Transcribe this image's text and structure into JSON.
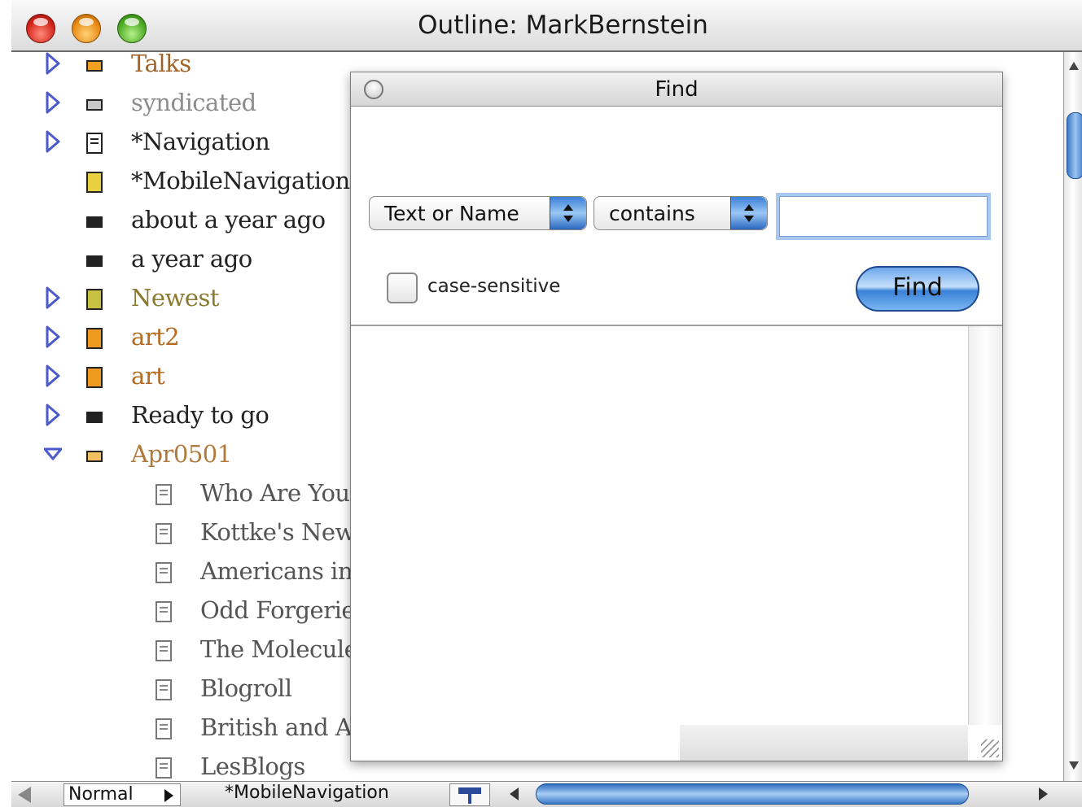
{
  "window": {
    "title": "Outline: MarkBernstein"
  },
  "outline": {
    "items": [
      {
        "label": "Talks",
        "expand": "collapsed",
        "level": 0,
        "icon": "flat",
        "icon_color": "#f0a020",
        "text_color": "#a06428"
      },
      {
        "label": "syndicated",
        "expand": "collapsed",
        "level": 0,
        "icon": "flat",
        "icon_color": "#c8c8c8",
        "text_color": "#8c8c8c"
      },
      {
        "label": "*Navigation",
        "expand": "collapsed",
        "level": 0,
        "icon": "doc",
        "icon_color": "#222222",
        "text_color": "#222222"
      },
      {
        "label": "*MobileNavigation",
        "expand": "none",
        "level": 0,
        "icon": "doc",
        "icon_color": "#e8d040",
        "text_color": "#222222"
      },
      {
        "label": "about a year ago",
        "expand": "none",
        "level": 0,
        "icon": "flat",
        "icon_color": "#222222",
        "text_color": "#222222"
      },
      {
        "label": "a year ago",
        "expand": "none",
        "level": 0,
        "icon": "flat",
        "icon_color": "#222222",
        "text_color": "#222222"
      },
      {
        "label": "Newest",
        "expand": "collapsed",
        "level": 0,
        "icon": "doc",
        "icon_color": "#c8c040",
        "text_color": "#8a7a30"
      },
      {
        "label": "art2",
        "expand": "collapsed",
        "level": 0,
        "icon": "doc",
        "icon_color": "#f09a20",
        "text_color": "#b46a20"
      },
      {
        "label": "art",
        "expand": "collapsed",
        "level": 0,
        "icon": "doc",
        "icon_color": "#f09a20",
        "text_color": "#b46a20"
      },
      {
        "label": "Ready to go",
        "expand": "collapsed",
        "level": 0,
        "icon": "flat",
        "icon_color": "#222222",
        "text_color": "#222222"
      },
      {
        "label": "Apr0501",
        "expand": "expanded",
        "level": 0,
        "icon": "flat",
        "icon_color": "#f2c060",
        "text_color": "#b07a3c"
      },
      {
        "label": "Who Are You?",
        "expand": "none",
        "level": 1,
        "icon": "doc",
        "icon_color": "#888888",
        "text_color": "#555555"
      },
      {
        "label": "Kottke's New I",
        "expand": "none",
        "level": 1,
        "icon": "doc",
        "icon_color": "#888888",
        "text_color": "#555555"
      },
      {
        "label": "Americans in F",
        "expand": "none",
        "level": 1,
        "icon": "doc",
        "icon_color": "#888888",
        "text_color": "#555555"
      },
      {
        "label": "Odd Forgeries",
        "expand": "none",
        "level": 1,
        "icon": "doc",
        "icon_color": "#888888",
        "text_color": "#555555"
      },
      {
        "label": "The Molecule",
        "expand": "none",
        "level": 1,
        "icon": "doc",
        "icon_color": "#888888",
        "text_color": "#555555"
      },
      {
        "label": "Blogroll",
        "expand": "none",
        "level": 1,
        "icon": "doc",
        "icon_color": "#888888",
        "text_color": "#555555"
      },
      {
        "label": "British and Am",
        "expand": "none",
        "level": 1,
        "icon": "doc",
        "icon_color": "#888888",
        "text_color": "#555555"
      },
      {
        "label": "LesBlogs",
        "expand": "none",
        "level": 1,
        "icon": "doc",
        "icon_color": "#888888",
        "text_color": "#555555"
      }
    ]
  },
  "statusbar": {
    "mode": "Normal",
    "current_note": "*MobileNavigation"
  },
  "find_dialog": {
    "title": "Find",
    "field_popup": "Text or Name",
    "operator_popup": "contains",
    "search_value": "",
    "case_sensitive_label": "case-sensitive",
    "case_sensitive_checked": false,
    "find_button": "Find"
  },
  "colors": {
    "triangle": "#4a5acc",
    "accent_blue": "#3a78c8"
  }
}
